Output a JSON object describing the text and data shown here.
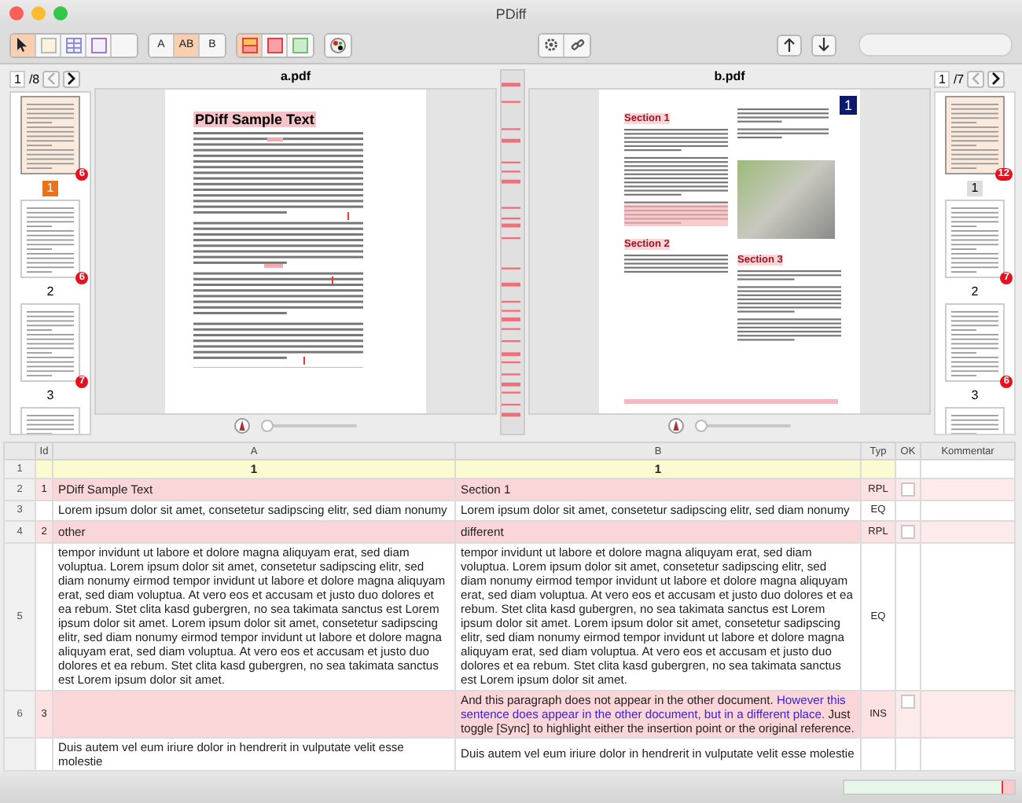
{
  "window": {
    "title": "PDiff"
  },
  "toolbar": {
    "tools": [
      {
        "kind": "pointer",
        "selected": true
      },
      {
        "kind": "page",
        "selected": false
      },
      {
        "kind": "grid",
        "selected": false
      },
      {
        "kind": "frame",
        "selected": false
      },
      {
        "kind": "blank",
        "selected": false
      }
    ],
    "text_modes": [
      {
        "label": "A",
        "selected": false
      },
      {
        "label": "AB",
        "selected": true
      },
      {
        "label": "B",
        "selected": false
      }
    ],
    "highlight_modes": [
      {
        "kind": "split",
        "selected": true
      },
      {
        "kind": "red",
        "selected": false
      },
      {
        "kind": "green",
        "selected": false
      }
    ]
  },
  "left_pane": {
    "focused": true,
    "page_field": "1",
    "page_total": "/8",
    "thumbnails": [
      {
        "label": "1",
        "badge": "6",
        "selected": true,
        "highlighted": true
      },
      {
        "label": "2",
        "badge": "6",
        "selected": false,
        "highlighted": false
      },
      {
        "label": "3",
        "badge": "7",
        "selected": false,
        "highlighted": false
      },
      {
        "selected": false,
        "highlighted": false
      }
    ]
  },
  "documents": [
    {
      "filename": "a.pdf",
      "kind": "plain",
      "heading": "PDiff Sample Text",
      "zoom": {
        "level": 0.05
      }
    },
    {
      "filename": "b.pdf",
      "kind": "columns",
      "left_headings": [
        "Section 1",
        "Section 2"
      ],
      "right_headings": [
        "Section 3"
      ],
      "page_badge": "1",
      "zoom": {
        "level": 0.05
      }
    }
  ],
  "right_pane": {
    "focused": false,
    "page_field": "1",
    "page_total": "/7",
    "thumbnails": [
      {
        "label": "1",
        "badge": "12",
        "selected": true,
        "highlighted": true
      },
      {
        "label": "2",
        "badge": "7",
        "selected": false,
        "highlighted": false
      },
      {
        "label": "3",
        "badge": "6",
        "selected": false,
        "highlighted": false
      },
      {
        "selected": false,
        "highlighted": false
      }
    ]
  },
  "table": {
    "columns": [
      "Id",
      "A",
      "B",
      "Typ",
      "OK",
      "Kommentar"
    ],
    "rows": [
      {
        "row": "1",
        "kind": "page",
        "a": "1",
        "b": "1"
      },
      {
        "row": "2",
        "id": "1",
        "kind": "diff",
        "a": "PDiff Sample Text",
        "b": "Section 1",
        "typ": "RPL",
        "ok": {
          "checked": false
        }
      },
      {
        "row": "3",
        "kind": "equal",
        "a": "Lorem ipsum dolor sit amet, consetetur sadipscing elitr, sed diam nonumy",
        "b": "Lorem ipsum dolor sit amet, consetetur sadipscing elitr, sed diam nonumy",
        "typ": "EQ"
      },
      {
        "row": "4",
        "id": "2",
        "kind": "diff",
        "a": "other",
        "b": "different",
        "typ": "RPL",
        "ok": {
          "checked": false
        }
      },
      {
        "row": "5",
        "kind": "equal",
        "a": "tempor invidunt ut labore et dolore magna aliquyam erat, sed diam voluptua. Lorem ipsum dolor sit amet, consetetur sadipscing elitr, sed diam nonumy eirmod tempor invidunt ut labore et dolore magna aliquyam erat, sed diam voluptua. At vero eos et accusam et justo duo dolores et ea rebum. Stet clita kasd gubergren, no sea takimata sanctus est Lorem ipsum dolor sit amet. Lorem ipsum dolor sit amet, consetetur sadipscing elitr, sed diam nonumy eirmod tempor invidunt ut labore et dolore magna aliquyam erat, sed diam voluptua. At vero eos et accusam et justo duo dolores et ea rebum. Stet clita kasd gubergren, no sea takimata sanctus est Lorem ipsum dolor sit amet.",
        "b": "tempor invidunt ut labore et dolore magna aliquyam erat, sed diam voluptua. Lorem ipsum dolor sit amet, consetetur sadipscing elitr, sed diam nonumy eirmod tempor invidunt ut labore et dolore magna aliquyam erat, sed diam voluptua. At vero eos et accusam et justo duo dolores et ea rebum. Stet clita kasd gubergren, no sea takimata sanctus est Lorem ipsum dolor sit amet. Lorem ipsum dolor sit amet, consetetur sadipscing elitr, sed diam nonumy eirmod tempor invidunt ut labore et dolore magna aliquyam erat, sed diam voluptua. At vero eos et accusam et justo duo dolores et ea rebum. Stet clita kasd gubergren, no sea takimata sanctus est Lorem ipsum dolor sit amet.",
        "typ": "EQ"
      },
      {
        "row": "6",
        "id": "3",
        "kind": "diff",
        "b_segments": [
          {
            "text": "And this paragraph does not appear in the other document. ",
            "moved": false
          },
          {
            "text": "However this sentence does appear in the other document, but in a different place.",
            "moved": true
          },
          {
            "text": " Just toggle [Sync] to highlight either the insertion point or the original reference.",
            "moved": false
          }
        ],
        "typ": "INS",
        "ok": {
          "checked": false
        }
      },
      {
        "kind": "equal",
        "a": "Duis autem vel eum iriure dolor in hendrerit in vulputate velit esse molestie",
        "b": "Duis autem vel eum iriure dolor in hendrerit in vulputate velit esse molestie"
      }
    ]
  },
  "status_bar": {
    "overview": {
      "level": 0.93
    }
  }
}
